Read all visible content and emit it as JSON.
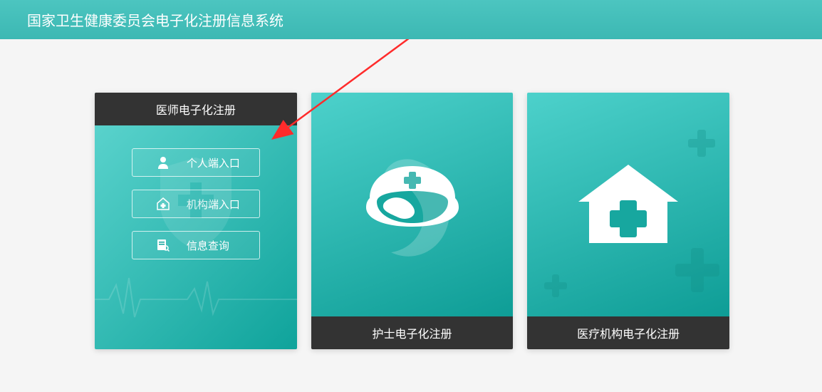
{
  "header": {
    "title": "国家卫生健康委员会电子化注册信息系统"
  },
  "cards": {
    "doctor": {
      "title": "医师电子化注册",
      "buttons": {
        "personal": {
          "label": "个人端入口",
          "icon": "person-icon"
        },
        "org": {
          "label": "机构端入口",
          "icon": "house-plus-icon"
        },
        "query": {
          "label": "信息查询",
          "icon": "search-doc-icon"
        }
      }
    },
    "nurse": {
      "title": "护士电子化注册"
    },
    "institution": {
      "title": "医疗机构电子化注册"
    }
  },
  "colors": {
    "headerTeal": "#3cb8b3",
    "dark": "#333333",
    "arrowRed": "#ff2b2b"
  }
}
